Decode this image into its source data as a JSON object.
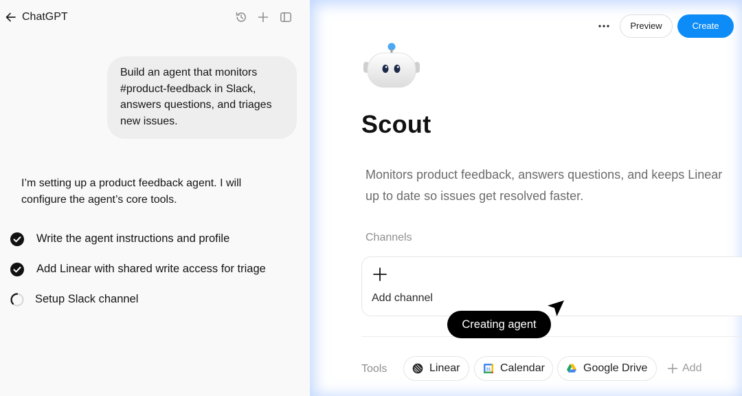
{
  "header": {
    "app_title": "ChatGPT",
    "icons": [
      "back-arrow-icon",
      "history-icon",
      "plus-icon",
      "sidebar-toggle-icon"
    ]
  },
  "chat": {
    "user_message": "Build an agent that monitors #product-feedback in Slack, answers questions, and triages new issues.",
    "assistant_message": "I’m setting up a product feedback agent. I will configure the agent’s core tools.",
    "tasks": [
      {
        "label": "Write the agent instructions and profile",
        "status": "done"
      },
      {
        "label": "Add Linear with shared write access for triage",
        "status": "done"
      },
      {
        "label": "Setup Slack channel",
        "status": "in-progress"
      }
    ]
  },
  "builder": {
    "preview_label": "Preview",
    "create_label": "Create",
    "agent_name": "Scout",
    "agent_description": "Monitors product feedback, answers questions, and keeps Linear up to date so issues get resolved faster.",
    "channels_label": "Channels",
    "add_channel_label": "Add channel",
    "tools_label": "Tools",
    "tools": [
      {
        "label": "Linear",
        "icon": "linear-icon"
      },
      {
        "label": "Calendar",
        "icon": "google-calendar-icon"
      },
      {
        "label": "Google Drive",
        "icon": "google-drive-icon"
      }
    ],
    "add_tool_label": "Add"
  },
  "overlay": {
    "status_text": "Creating agent"
  },
  "colors": {
    "accent": "#0d8cf7",
    "user_bubble": "#eeeeee",
    "left_panel": "#f9f9f9",
    "status_pill": "#000000"
  }
}
